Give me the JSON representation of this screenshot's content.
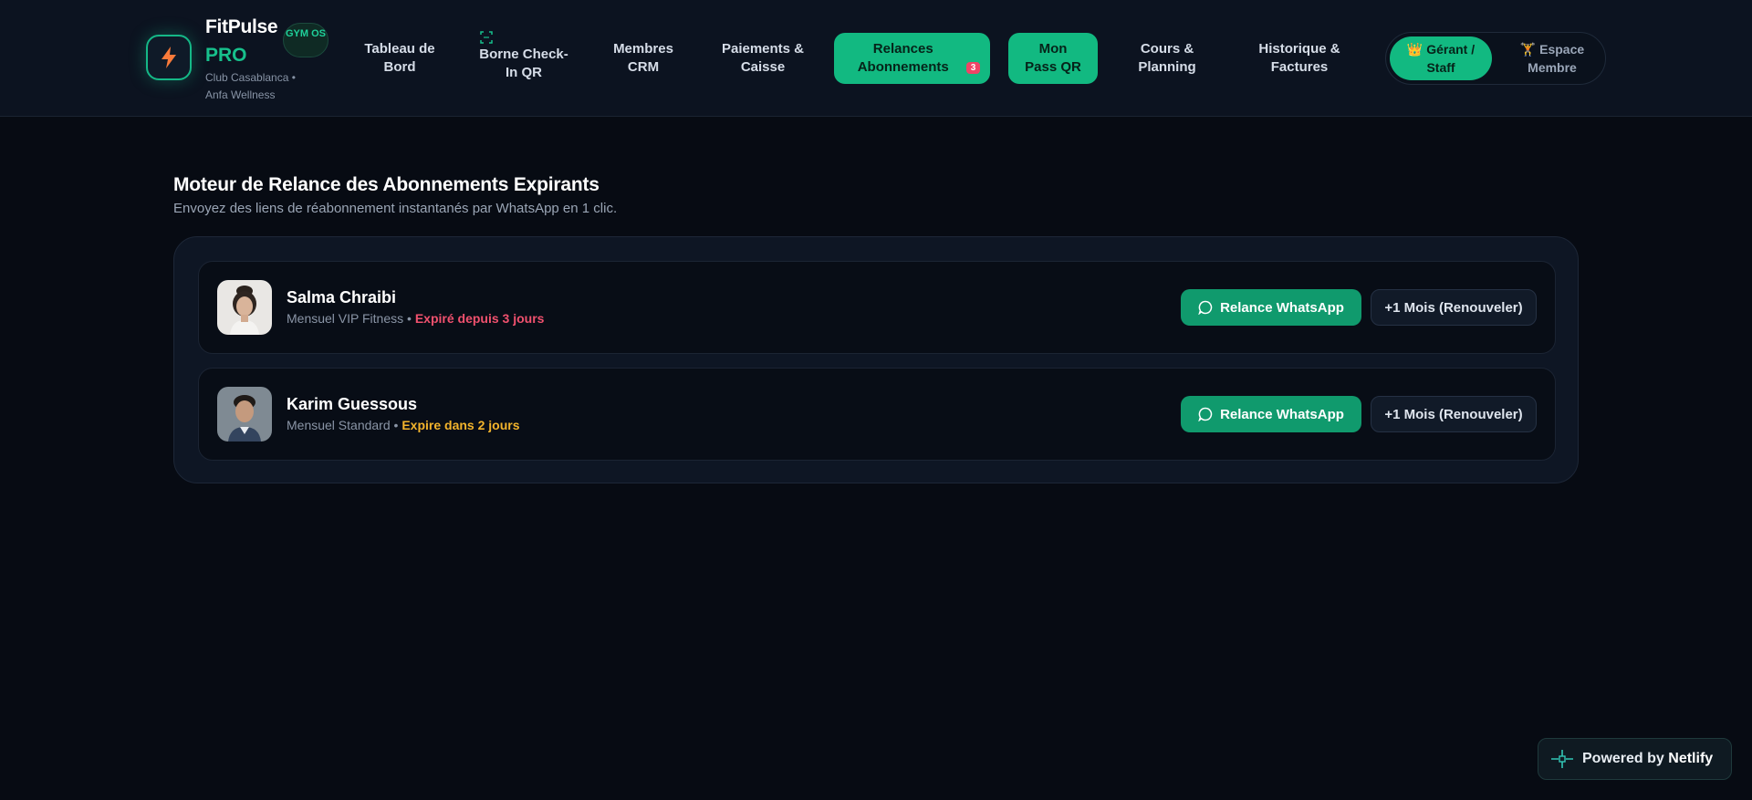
{
  "brand": {
    "name": "FitPulse",
    "tier": "PRO",
    "badge": "GYM OS",
    "location": "Club Casablanca • Anfa Wellness",
    "logo_icon": "lightning-icon",
    "accent": "#12b981"
  },
  "nav": {
    "items": [
      {
        "label": "Tableau de Bord"
      },
      {
        "label": "Borne Check-In QR",
        "icon": "qr-scan-icon"
      },
      {
        "label": "Membres CRM"
      },
      {
        "label": "Paiements & Caisse"
      },
      {
        "label": "Relances Abonnements",
        "badge": "3"
      },
      {
        "label": "Mon Pass QR"
      },
      {
        "label": "Cours & Planning"
      },
      {
        "label": "Historique & Factures"
      }
    ]
  },
  "roles": {
    "staff": "👑 Gérant / Staff",
    "member": "🏋 Espace Membre"
  },
  "page": {
    "title": "Moteur de Relance des Abonnements Expirants",
    "subtitle": "Envoyez des liens de réabonnement instantanés par WhatsApp en 1 clic."
  },
  "members": [
    {
      "name": "Salma Chraibi",
      "plan": "Mensuel VIP Fitness",
      "separator": " • ",
      "status": "Expiré depuis 3 jours",
      "status_color": "#f0516e",
      "whatsapp_label": "Relance WhatsApp",
      "renew_label": "+1 Mois (Renouveler)"
    },
    {
      "name": "Karim Guessous",
      "plan": "Mensuel Standard",
      "separator": " • ",
      "status": "Expire dans 2 jours",
      "status_color": "#f3b42c",
      "whatsapp_label": "Relance WhatsApp",
      "renew_label": "+1 Mois (Renouveler)"
    }
  ],
  "footer": {
    "powered_by": "Powered by",
    "brand": "Netlify"
  }
}
